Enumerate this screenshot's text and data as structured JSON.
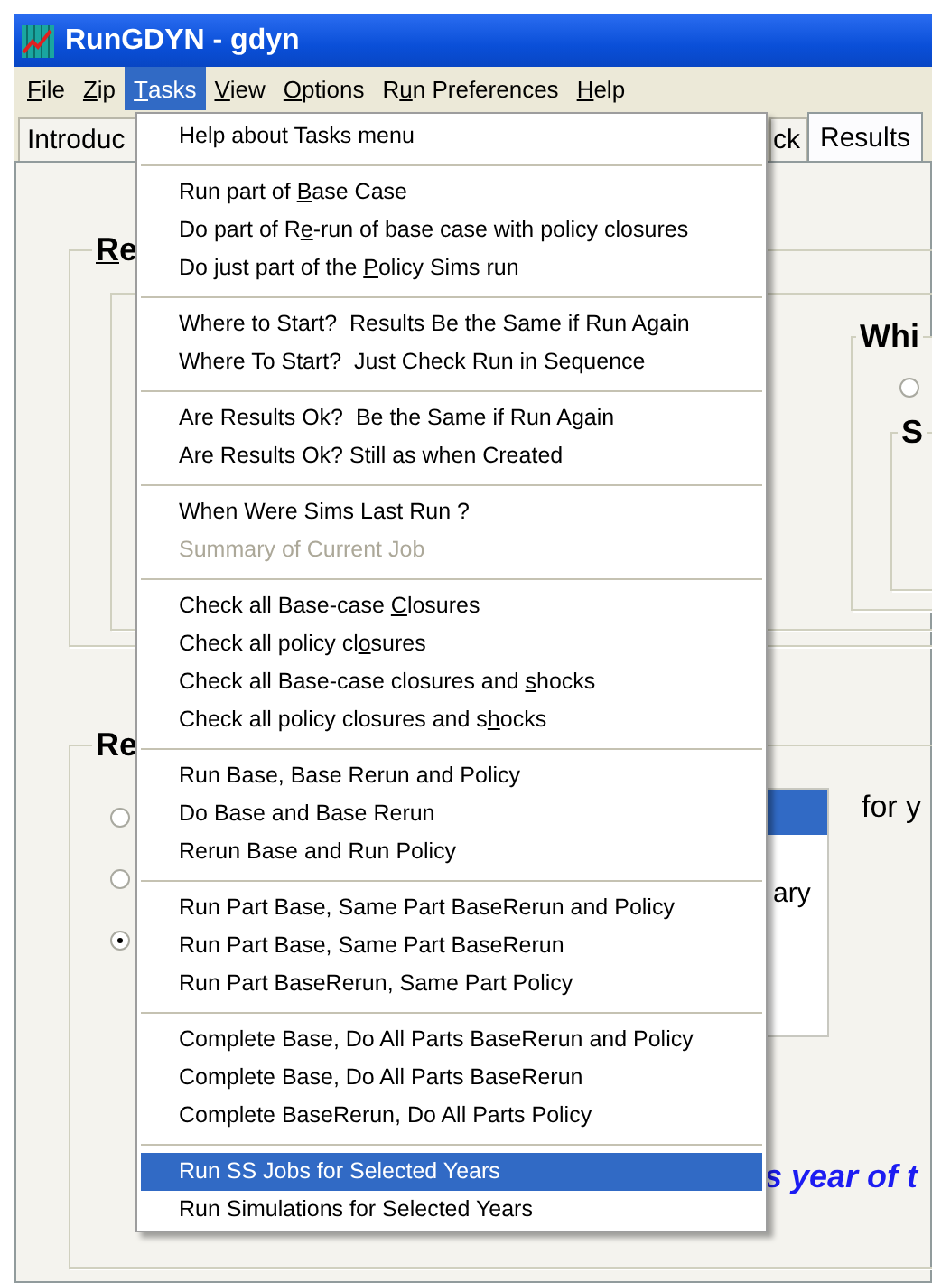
{
  "window": {
    "title": "RunGDYN - gdyn"
  },
  "menu_bar": [
    {
      "key": "F",
      "post": "ile",
      "selected": false
    },
    {
      "key": "Z",
      "post": "ip",
      "selected": false
    },
    {
      "key": "T",
      "post": "asks",
      "selected": true
    },
    {
      "key": "V",
      "post": "iew",
      "selected": false
    },
    {
      "key": "O",
      "post": "ptions",
      "selected": false
    },
    {
      "pre": "R",
      "key": "u",
      "post": "n Preferences",
      "selected": false
    },
    {
      "key": "H",
      "post": "elp",
      "selected": false
    }
  ],
  "tabs": [
    {
      "label": "Introduc",
      "selected": false
    },
    {
      "label": "ck",
      "selected": false
    },
    {
      "label": "Results",
      "selected": true
    }
  ],
  "upper_group": {
    "key": "R",
    "post": "e"
  },
  "right_group": {
    "label": "Whi",
    "radio": {
      "selected": false
    },
    "subgroup_label": "S"
  },
  "lower_group": {
    "label": "Re",
    "radios": [
      {
        "selected": false
      },
      {
        "selected": false
      },
      {
        "selected": true
      }
    ],
    "list_text": "ary",
    "side_text": "for y",
    "note": "s year of t"
  },
  "tasks_menu": [
    [
      {
        "label": "Help about Tasks menu",
        "disabled": false,
        "selected": false
      }
    ],
    [
      {
        "pre": "Run part of ",
        "key": "B",
        "post": "ase Case",
        "disabled": false,
        "selected": false
      },
      {
        "pre": "Do part of R",
        "key": "e",
        "post": "-run of base case with policy closures",
        "disabled": false,
        "selected": false
      },
      {
        "pre": "Do just part of the ",
        "key": "P",
        "post": "olicy Sims run",
        "disabled": false,
        "selected": false
      }
    ],
    [
      {
        "label": "Where to Start?  Results Be the Same if Run Again",
        "disabled": false,
        "selected": false
      },
      {
        "label": "Where To Start?  Just Check Run in Sequence",
        "disabled": false,
        "selected": false
      }
    ],
    [
      {
        "label": "Are Results Ok?  Be the Same if Run Again",
        "disabled": false,
        "selected": false
      },
      {
        "label": "Are Results Ok? Still as when Created",
        "disabled": false,
        "selected": false
      }
    ],
    [
      {
        "label": "When Were Sims Last Run ?",
        "disabled": false,
        "selected": false
      },
      {
        "label": "Summary of Current Job",
        "disabled": true,
        "selected": false
      }
    ],
    [
      {
        "pre": "Check all Base-case ",
        "key": "C",
        "post": "losures",
        "disabled": false,
        "selected": false
      },
      {
        "pre": "Check all policy cl",
        "key": "o",
        "post": "sures",
        "disabled": false,
        "selected": false
      },
      {
        "pre": "Check all Base-case closures and ",
        "key": "s",
        "post": "hocks",
        "disabled": false,
        "selected": false
      },
      {
        "pre": "Check all policy closures and s",
        "key": "h",
        "post": "ocks",
        "disabled": false,
        "selected": false
      }
    ],
    [
      {
        "label": "Run Base, Base Rerun and Policy",
        "disabled": false,
        "selected": false
      },
      {
        "label": "Do Base and Base Rerun",
        "disabled": false,
        "selected": false
      },
      {
        "label": "Rerun Base and Run Policy",
        "disabled": false,
        "selected": false
      }
    ],
    [
      {
        "label": "Run Part Base, Same Part BaseRerun and Policy",
        "disabled": false,
        "selected": false
      },
      {
        "label": "Run Part Base, Same Part BaseRerun",
        "disabled": false,
        "selected": false
      },
      {
        "label": "Run Part BaseRerun, Same Part Policy",
        "disabled": false,
        "selected": false
      }
    ],
    [
      {
        "label": "Complete Base, Do All Parts BaseRerun and Policy",
        "disabled": false,
        "selected": false
      },
      {
        "label": "Complete Base, Do All Parts BaseRerun",
        "disabled": false,
        "selected": false
      },
      {
        "label": "Complete BaseRerun, Do All Parts Policy",
        "disabled": false,
        "selected": false
      }
    ],
    [
      {
        "label": "Run SS Jobs for Selected Years",
        "disabled": false,
        "selected": true
      },
      {
        "label": "Run Simulations for Selected Years",
        "disabled": false,
        "selected": false
      }
    ]
  ]
}
